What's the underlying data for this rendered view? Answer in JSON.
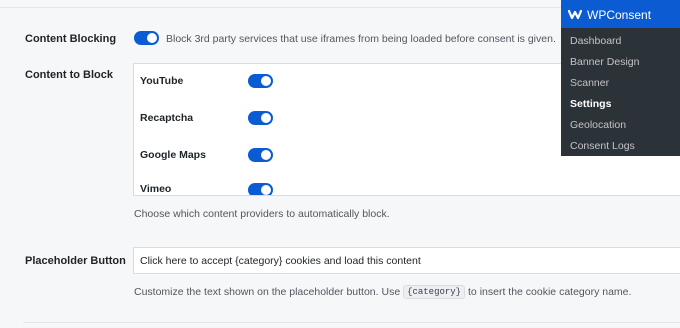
{
  "settings": {
    "content_blocking": {
      "label": "Content Blocking",
      "enabled": true,
      "description": "Block 3rd party services that use iframes from being loaded before consent is given."
    },
    "content_to_block": {
      "label": "Content to Block",
      "providers": [
        {
          "name": "YouTube",
          "enabled": true
        },
        {
          "name": "Recaptcha",
          "enabled": true
        },
        {
          "name": "Google Maps",
          "enabled": true
        },
        {
          "name": "Vimeo",
          "enabled": true
        }
      ],
      "help": "Choose which content providers to automatically block."
    },
    "placeholder_button": {
      "label": "Placeholder Button",
      "value": "Click here to accept {category} cookies and load this content",
      "help_before": "Customize the text shown on the placeholder button. Use",
      "help_code": "{category}",
      "help_after": "to insert the cookie category name."
    }
  },
  "admin_menu": {
    "title": "WPConsent",
    "items": [
      "Dashboard",
      "Banner Design",
      "Scanner",
      "Settings",
      "Geolocation",
      "Consent Logs"
    ],
    "active": "Settings"
  },
  "colors": {
    "accent": "#0b5bd3",
    "menu_bg": "#2c3338",
    "page_bg": "#f6f7f9"
  }
}
